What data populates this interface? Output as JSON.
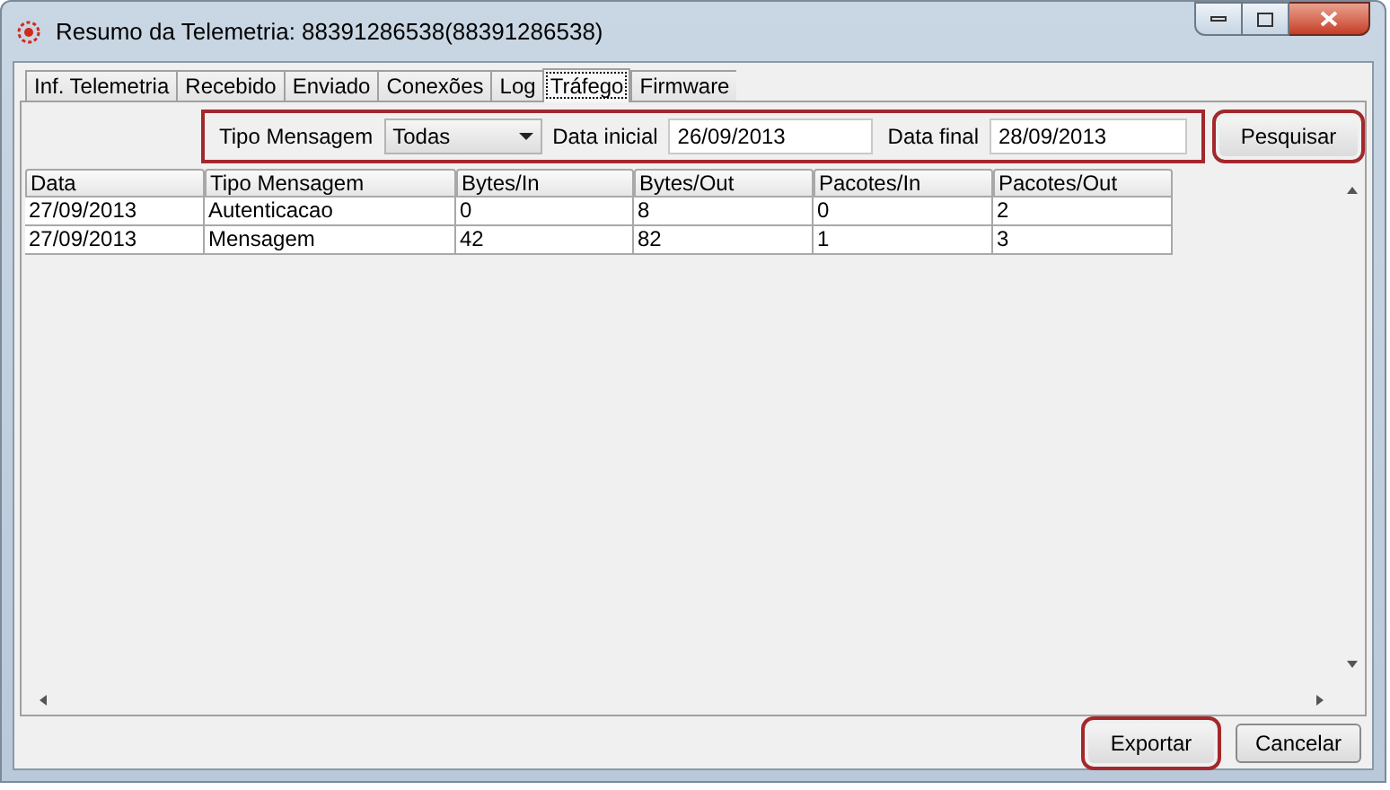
{
  "window": {
    "title": "Resumo da Telemetria: 88391286538(88391286538)"
  },
  "tabs": [
    {
      "label": "Inf. Telemetria",
      "selected": false
    },
    {
      "label": "Recebido",
      "selected": false
    },
    {
      "label": "Enviado",
      "selected": false
    },
    {
      "label": "Conexões",
      "selected": false
    },
    {
      "label": "Log",
      "selected": false
    },
    {
      "label": "Tráfego",
      "selected": true
    },
    {
      "label": "Firmware",
      "selected": false
    }
  ],
  "filter": {
    "highlighted": true,
    "type_label": "Tipo Mensagem",
    "type_value": "Todas",
    "start_label": "Data inicial",
    "start_value": "26/09/2013",
    "end_label": "Data final",
    "end_value": "28/09/2013"
  },
  "search_button": {
    "label": "Pesquisar",
    "highlighted": true
  },
  "table": {
    "columns": [
      "Data",
      "Tipo Mensagem",
      "Bytes/In",
      "Bytes/Out",
      "Pacotes/In",
      "Pacotes/Out"
    ],
    "rows": [
      [
        "27/09/2013",
        "Autenticacao",
        "0",
        "8",
        "0",
        "2"
      ],
      [
        "27/09/2013",
        "Mensagem",
        "42",
        "82",
        "1",
        "3"
      ]
    ]
  },
  "buttons": [
    {
      "label": "Exportar",
      "highlighted": true
    },
    {
      "label": "Cancelar",
      "highlighted": false
    }
  ]
}
